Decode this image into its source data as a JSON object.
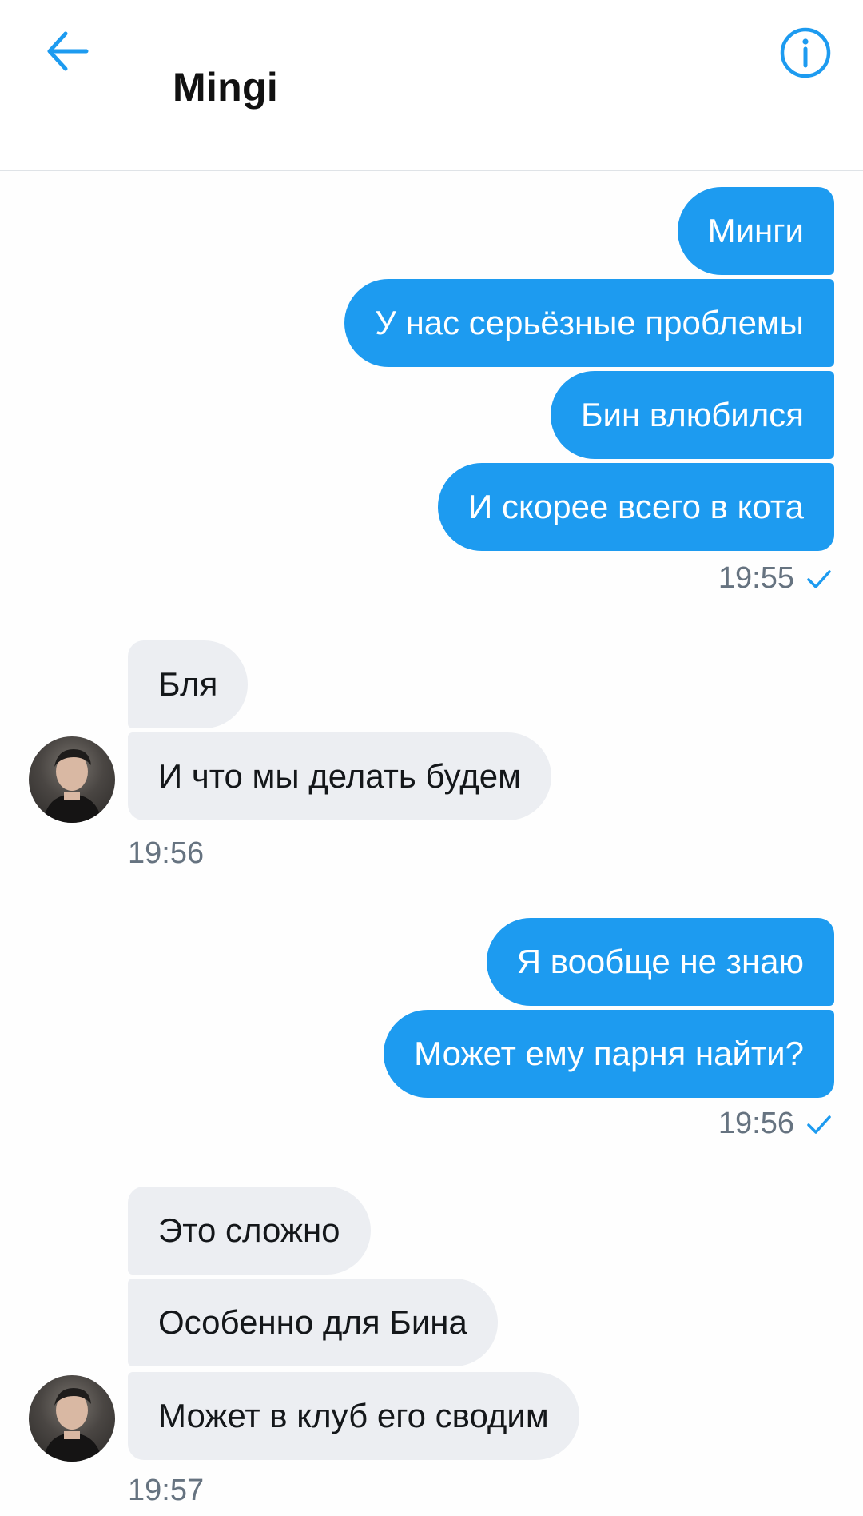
{
  "header": {
    "title": "Mingi",
    "accent_color": "#1d9bf0",
    "back_icon": "arrow-left-icon",
    "info_icon": "info-icon"
  },
  "messages": [
    {
      "direction": "out",
      "text": "Минги"
    },
    {
      "direction": "out",
      "text": "У нас серьёзные проблемы"
    },
    {
      "direction": "out",
      "text": "Бин влюбился"
    },
    {
      "direction": "out",
      "text": "И скорее всего в кота"
    },
    {
      "direction": "in",
      "text": "Бля"
    },
    {
      "direction": "in",
      "text": "И что мы делать будем"
    },
    {
      "direction": "out",
      "text": "Я вообще не знаю"
    },
    {
      "direction": "out",
      "text": "Может ему парня найти?"
    },
    {
      "direction": "in",
      "text": "Это сложно"
    },
    {
      "direction": "in",
      "text": "Особенно для Бина"
    },
    {
      "direction": "in",
      "text": "Может в клуб его сводим"
    }
  ],
  "timestamps": {
    "group1": "19:55",
    "group2": "19:56",
    "group3": "19:56",
    "group4": "19:57"
  },
  "colors": {
    "outgoing_bubble": "#1d9bf0",
    "incoming_bubble": "#eceef2",
    "timestamp_text": "#667380"
  }
}
